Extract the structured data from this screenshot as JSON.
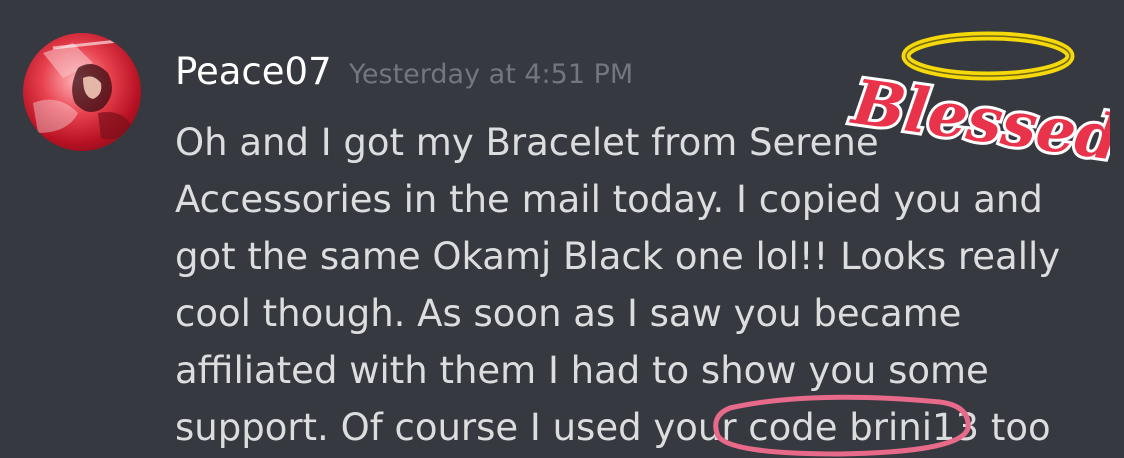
{
  "message": {
    "author": "Peace07",
    "timestamp": "Yesterday at 4:51 PM",
    "avatar_icon": "anime-character-avatar",
    "lines": [
      "Oh and I got my  Bracelet from Serene",
      "Accessories in the mail today. I copied you and",
      "got the same Okamj Black one lol!! Looks really",
      "cool though. As soon as I saw you became",
      "affiliated with them I had to show you some",
      "support. Of course I used your code brini13 too"
    ]
  },
  "sticker": {
    "text": "Blessed",
    "text_color": "#e8334a",
    "halo_color": "#f5d90a"
  },
  "annotation": {
    "circle_color": "#e86a8a"
  }
}
